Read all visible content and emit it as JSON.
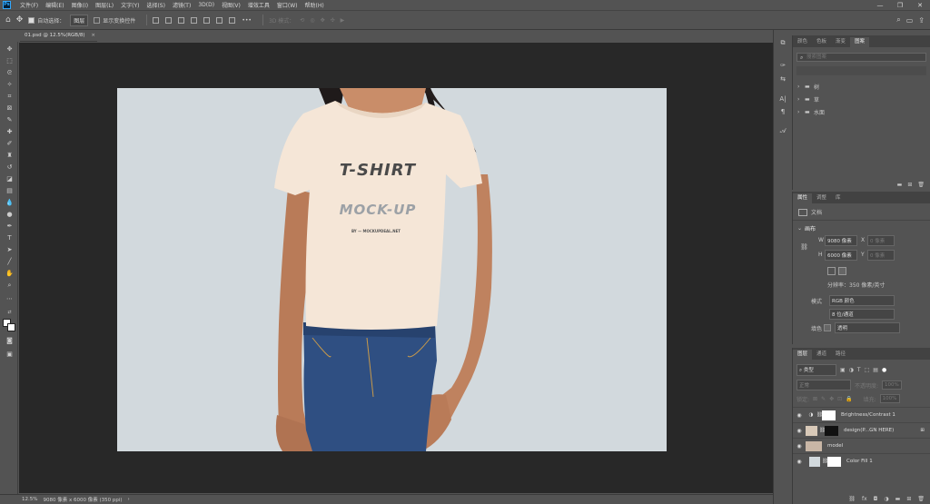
{
  "app": {
    "logo": "Ps"
  },
  "menu": [
    "文件(F)",
    "编辑(E)",
    "图像(I)",
    "图层(L)",
    "文字(Y)",
    "选择(S)",
    "滤镜(T)",
    "3D(D)",
    "视图(V)",
    "增效工具",
    "窗口(W)",
    "帮助(H)"
  ],
  "window_controls": [
    "—",
    "❐",
    "✕"
  ],
  "options": {
    "auto_select_label": "自动选择：",
    "auto_select_value": "图层",
    "show_transform_label": "显示变换控件",
    "mode3d_label": "3D 模式：",
    "more": "•••"
  },
  "document": {
    "tab_title": "01.psd @ 12.5%(RGB/8)",
    "close": "×"
  },
  "status": {
    "zoom": "12.5%",
    "dims": "9080 像素 x 6000 像素 (350 ppi)",
    "arrow": "›"
  },
  "mockup": {
    "line1": "T-SHIRT",
    "line2": "MOCK-UP",
    "credit": "BY — MOCKUPDEAL.NET"
  },
  "swatches_panel": {
    "tabs": [
      "颜色",
      "色板",
      "渐变",
      "图案"
    ],
    "search_placeholder": "搜索图案",
    "groups": [
      "树",
      "草",
      "水面"
    ]
  },
  "properties_panel": {
    "tabs": [
      "属性",
      "调整",
      "库"
    ],
    "doc_label": "文档",
    "canvas_header": "画布",
    "w_label": "W",
    "w_value": "9080 像素",
    "h_label": "H",
    "h_value": "6000 像素",
    "x_label": "X",
    "x_value": "0 像素",
    "y_label": "Y",
    "y_value": "0 像素",
    "resolution": "分辨率：350 像素/英寸",
    "mode_label": "模式",
    "mode_value": "RGB 颜色",
    "depth_value": "8 位/通道",
    "fill_label": "填色",
    "fill_value": "透明"
  },
  "layers_panel": {
    "tabs": [
      "图层",
      "通道",
      "路径"
    ],
    "filter": "类型",
    "blend": "正常",
    "opacity_label": "不透明度:",
    "opacity_value": "100%",
    "lock_label": "锁定:",
    "fill_label": "填充:",
    "fill_value": "100%",
    "layers": [
      {
        "name": "Brightness/Contrast 1"
      },
      {
        "name": "design(P...GN HERE)"
      },
      {
        "name": "model"
      },
      {
        "name": "Color Fill 1"
      }
    ]
  },
  "colors": {
    "accent": "#31a8ff",
    "canvas_bg": "#d2d9dd",
    "tshirt": "#f5e6d7",
    "jeans": "#2f4f82",
    "skin": "#b97b58"
  }
}
